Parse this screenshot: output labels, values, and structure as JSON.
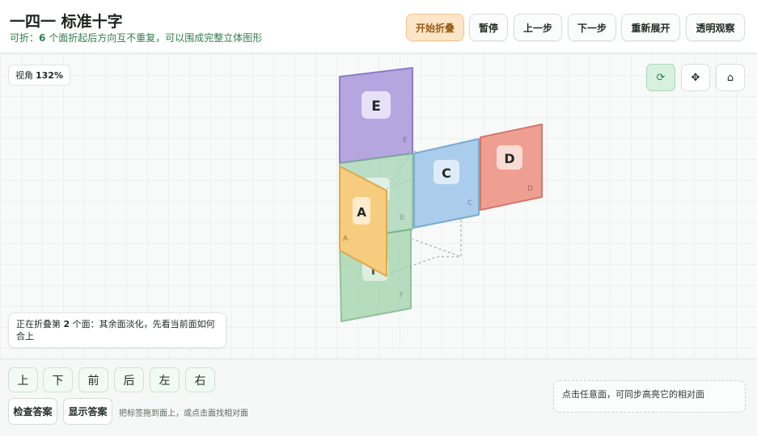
{
  "header": {
    "title": "一四一 标准十字",
    "subtitle_prefix": "可折：",
    "subtitle_count": "6",
    "subtitle_rest": " 个面折起后方向互不重复，可以围成完整立体图形"
  },
  "toolbar": {
    "start_fold": "开始折叠",
    "pause": "暂停",
    "prev_step": "上一步",
    "next_step": "下一步",
    "reset_unfold": "重新展开",
    "transparent_view": "透明观察"
  },
  "view": {
    "label": "视角",
    "zoom": "132%"
  },
  "view_controls": {
    "rotate_icon": "⟳",
    "move_icon": "✥",
    "home_icon": "⌂"
  },
  "faces": [
    {
      "label": "E",
      "corner": "E",
      "color": "#b6a6e0",
      "border": "#8d7bc8"
    },
    {
      "label": "B",
      "corner": "B",
      "color": "#a6d4b4",
      "border": "#78b58c"
    },
    {
      "label": "C",
      "corner": "C",
      "color": "#a9cdea",
      "border": "#7aaad3"
    },
    {
      "label": "D",
      "corner": "D",
      "color": "#ef9f92",
      "border": "#d5766a"
    },
    {
      "label": "F",
      "corner": "F",
      "color": "#9fd2a8",
      "border": "#6fb07c"
    },
    {
      "label": "A",
      "corner": "A",
      "color": "#f6cd7e",
      "border": "#e0a84a"
    }
  ],
  "status": {
    "text_prefix": "正在折叠第 ",
    "step": "2",
    "text_rest": " 个面：其余面淡化，先看当前面如何合上"
  },
  "directions": [
    "上",
    "下",
    "前",
    "后",
    "左",
    "右"
  ],
  "actions": {
    "check_answer": "检查答案",
    "show_answer": "显示答案",
    "hint": "把标签拖到面上，或点击面找相对面"
  },
  "info": {
    "text": "点击任意面，可同步高亮它的相对面"
  }
}
